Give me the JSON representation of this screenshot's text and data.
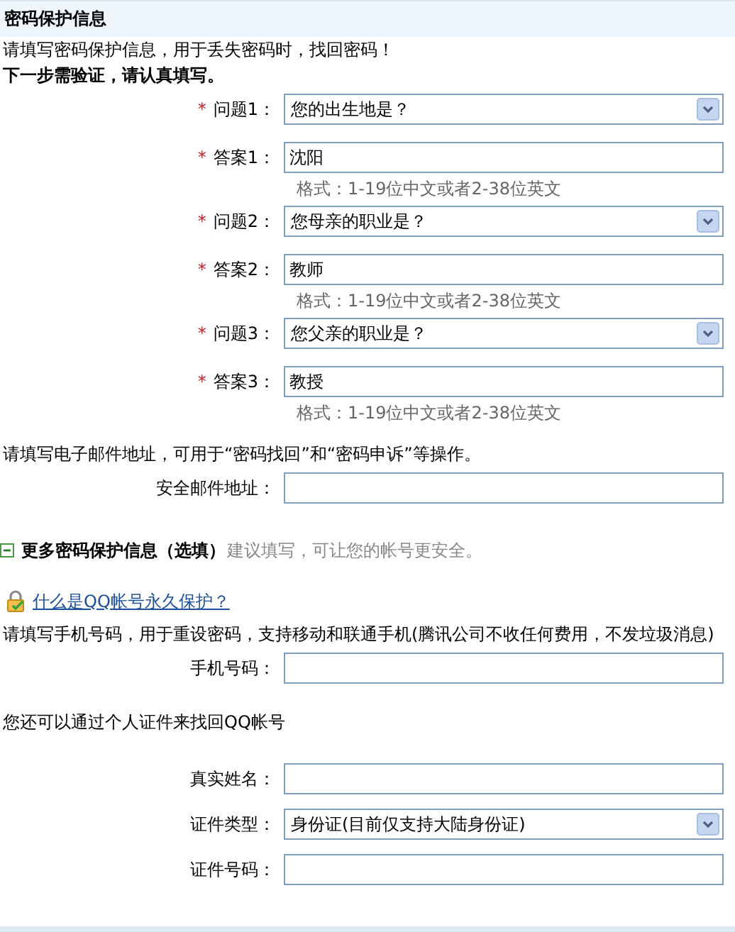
{
  "header": {
    "title": "密码保护信息"
  },
  "intro": {
    "text": "请填写密码保护信息，用于丢失密码时，找回密码！",
    "emphasis": "下一步需验证，请认真填写。"
  },
  "questions": [
    {
      "kind": "select",
      "mark": "*",
      "label": "问题1：",
      "value": "您的出生地是？"
    },
    {
      "kind": "text",
      "mark": "*",
      "label": "答案1：",
      "value": "沈阳",
      "hint": "格式：1-19位中文或者2-38位英文"
    },
    {
      "kind": "select",
      "mark": "*",
      "label": "问题2：",
      "value": "您母亲的职业是？"
    },
    {
      "kind": "text",
      "mark": "*",
      "label": "答案2：",
      "value": "教师",
      "hint": "格式：1-19位中文或者2-38位英文"
    },
    {
      "kind": "select",
      "mark": "*",
      "label": "问题3：",
      "value": "您父亲的职业是？"
    },
    {
      "kind": "text",
      "mark": "*",
      "label": "答案3：",
      "value": "教授",
      "hint": "格式：1-19位中文或者2-38位英文"
    }
  ],
  "email": {
    "note": "请填写电子邮件地址，可用于“密码找回”和“密码申诉”等操作。",
    "fields": [
      {
        "kind": "text",
        "label": "安全邮件地址："
      }
    ]
  },
  "more": {
    "expanded": true,
    "title": "更多密码保护信息（选填）",
    "tip": "建议填写，可让您的帐号更安全。"
  },
  "protect_link": "什么是QQ帐号永久保护？",
  "phone": {
    "note": "请填写手机号码，用于重设密码，支持移动和联通手机(腾讯公司不收任何费用，不发垃圾消息)",
    "fields": [
      {
        "kind": "text",
        "label": "手机号码："
      }
    ]
  },
  "identity": {
    "note": "您还可以通过个人证件来找回QQ帐号",
    "fields": [
      {
        "kind": "text",
        "label": "真实姓名："
      },
      {
        "kind": "select",
        "label": "证件类型：",
        "value": "身份证(目前仅支持大陆身份证)"
      },
      {
        "kind": "text",
        "label": "证件号码："
      }
    ]
  }
}
